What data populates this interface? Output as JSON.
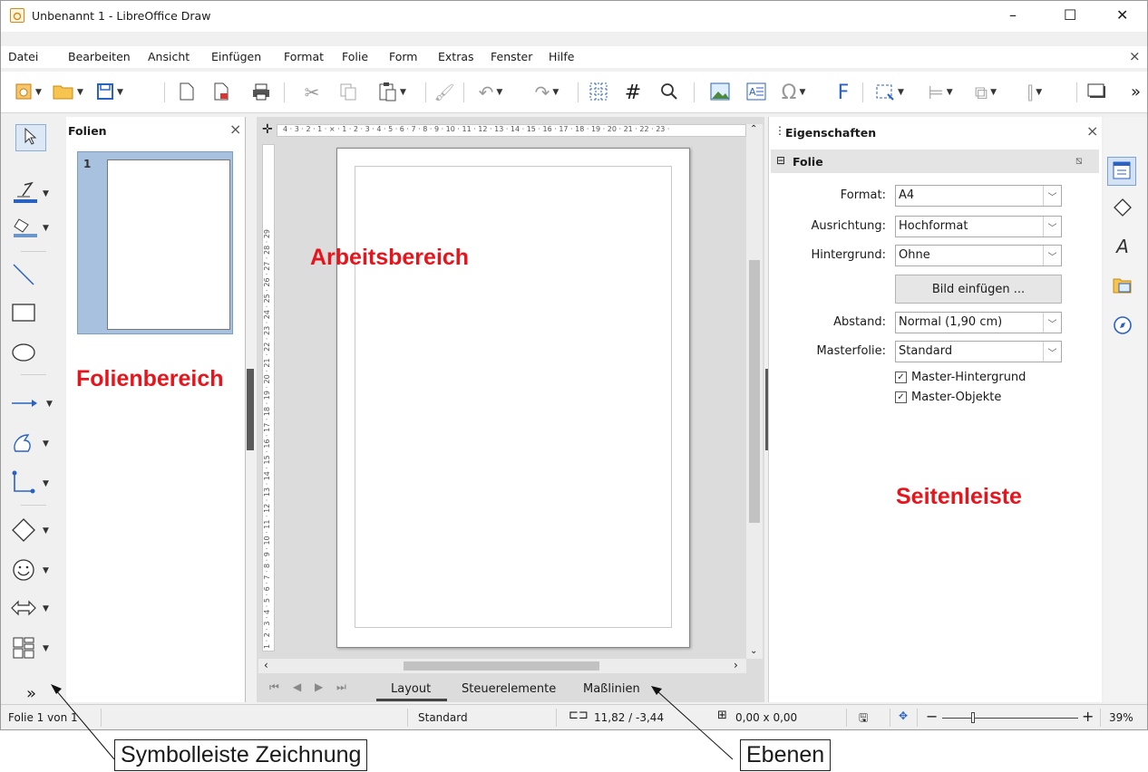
{
  "window": {
    "title": "Unbenannt 1 - LibreOffice Draw",
    "controls": {
      "minimize": "–",
      "maximize": "☐",
      "close": "✕"
    }
  },
  "menubar": {
    "items": [
      "Datei",
      "Bearbeiten",
      "Ansicht",
      "Einfügen",
      "Format",
      "Folie",
      "Form",
      "Extras",
      "Fenster",
      "Hilfe"
    ],
    "close": "×"
  },
  "toolbar": {
    "overflow": "»"
  },
  "drawbar": {
    "overflow": "»"
  },
  "slides_pane": {
    "title": "Folien",
    "close": "×",
    "slide_number": "1"
  },
  "ruler": {
    "h_ticks": "4 · 3 · 2 · 1 · ⨯ · 1 · 2 · 3 · 4 · 5 · 6 · 7 · 8 · 9 · 10 · 11 · 12 · 13 · 14 · 15 · 16 · 17 · 18 · 19 · 20 · 21 · 22 · 23 ·",
    "v_ticks": "1 · 2 · 3 · 4 · 5 · 6 · 7 · 8 · 9 · 10 · 11 · 12 · 13 · 14 · 15 · 16 · 17 · 18 · 19 · 20 · 21 · 22 · 23 · 24 · 25 · 26 · 27 · 28 · 29"
  },
  "layers": {
    "tabs": [
      "Layout",
      "Steuerelemente",
      "Maßlinien"
    ],
    "active": "Layout"
  },
  "sidebar": {
    "title": "Eigenschaften",
    "close": "×",
    "more": "⋮",
    "section": "Folie",
    "fields": {
      "format_label": "Format:",
      "format_value": "A4",
      "orientation_label": "Ausrichtung:",
      "orientation_value": "Hochformat",
      "background_label": "Hintergrund:",
      "background_value": "Ohne",
      "insert_image": "Bild einfügen ...",
      "margin_label": "Abstand:",
      "margin_value": "Normal (1,90 cm)",
      "master_label": "Masterfolie:",
      "master_value": "Standard"
    },
    "checkboxes": [
      {
        "label": "Master-Hintergrund",
        "checked": true
      },
      {
        "label": "Master-Objekte",
        "checked": true
      }
    ]
  },
  "statusbar": {
    "slide": "Folie 1 von 1",
    "layout": "Standard",
    "position": "11,82 / -3,44",
    "size": "0,00 x 0,00",
    "zoom": "39%",
    "zoom_minus": "−",
    "zoom_plus": "+"
  },
  "annotations": {
    "workarea": "Arbeitsbereich",
    "slidepane": "Folienbereich",
    "sidebar": "Seitenleiste",
    "drawbar": "Symbolleiste Zeichnung",
    "layers": "Ebenen"
  },
  "colors": {
    "accent": "#2a62c3",
    "annotation_red": "#e8141b",
    "slide_thumb_bg": "#a7c1df"
  }
}
